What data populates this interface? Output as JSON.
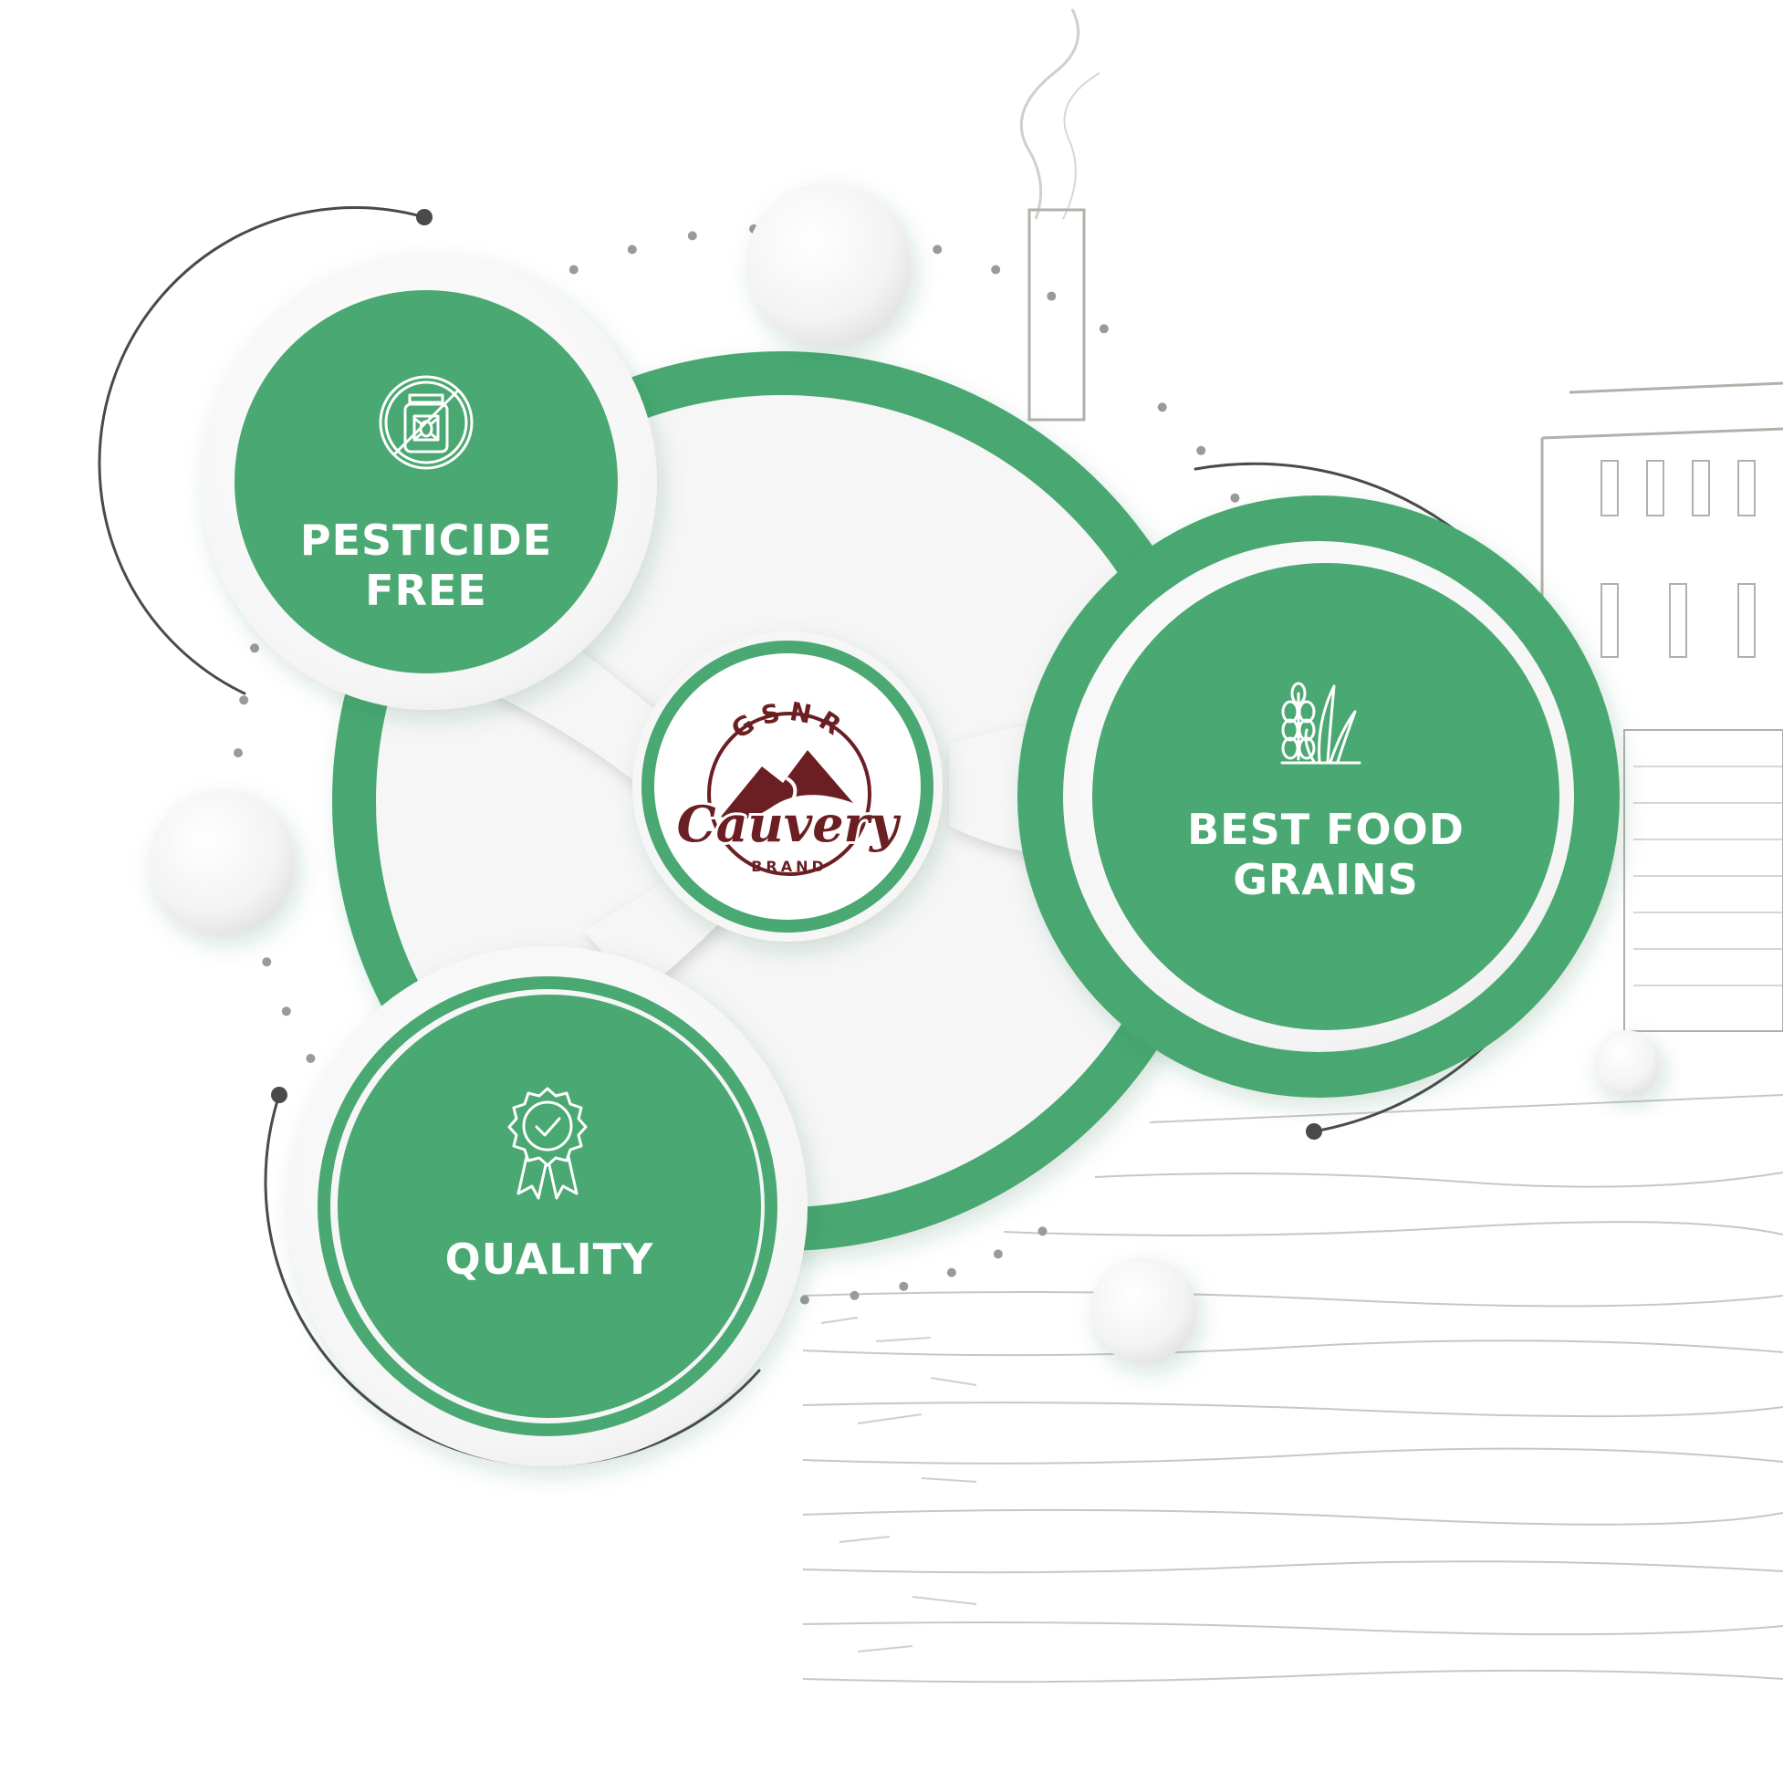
{
  "colors": {
    "accent_green": "#4aa872",
    "accent_green_dark": "#3f9a66",
    "logo_brown": "#6b1f22",
    "connector_gray": "#4a4a4a",
    "sketch_gray": "#9a968d"
  },
  "logo": {
    "arc_top": "GSNR",
    "script": "Cauvery",
    "arc_bottom": "BRAND"
  },
  "features": [
    {
      "id": "pesticide-free",
      "icon": "no-pesticide-bottle-icon",
      "lines": [
        "PESTICIDE",
        "FREE"
      ]
    },
    {
      "id": "best-food-grains",
      "icon": "wheat-grain-icon",
      "lines": [
        "BEST FOOD",
        "GRAINS"
      ]
    },
    {
      "id": "quality",
      "icon": "quality-badge-icon",
      "lines": [
        "QUALITY"
      ]
    }
  ]
}
